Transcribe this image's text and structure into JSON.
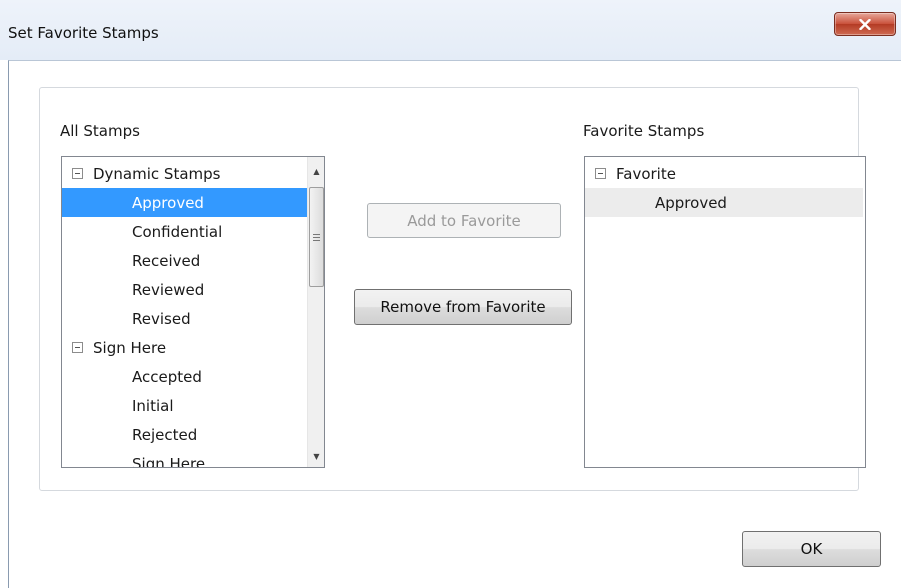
{
  "window": {
    "title": "Set Favorite Stamps",
    "close_label": "x"
  },
  "all_stamps": {
    "label": "All Stamps",
    "groups": [
      {
        "name": "Dynamic Stamps",
        "expanded": true,
        "items": [
          "Approved",
          "Confidential",
          "Received",
          "Reviewed",
          "Revised"
        ]
      },
      {
        "name": "Sign Here",
        "expanded": true,
        "items": [
          "Accepted",
          "Initial",
          "Rejected",
          "Sign Here"
        ]
      }
    ],
    "selected": "Approved"
  },
  "favorite_stamps": {
    "label": "Favorite Stamps",
    "groups": [
      {
        "name": "Favorite",
        "expanded": true,
        "items": [
          "Approved"
        ]
      }
    ]
  },
  "buttons": {
    "add": "Add to Favorite",
    "remove": "Remove from Favorite",
    "ok": "OK"
  },
  "icons": {
    "close": "close-icon",
    "expander": "collapse-minus-icon",
    "scroll_up": "scroll-up-arrow-icon",
    "scroll_down": "scroll-down-arrow-icon"
  },
  "colors": {
    "selection": "#3399ff",
    "close_button": "#c9503a"
  }
}
